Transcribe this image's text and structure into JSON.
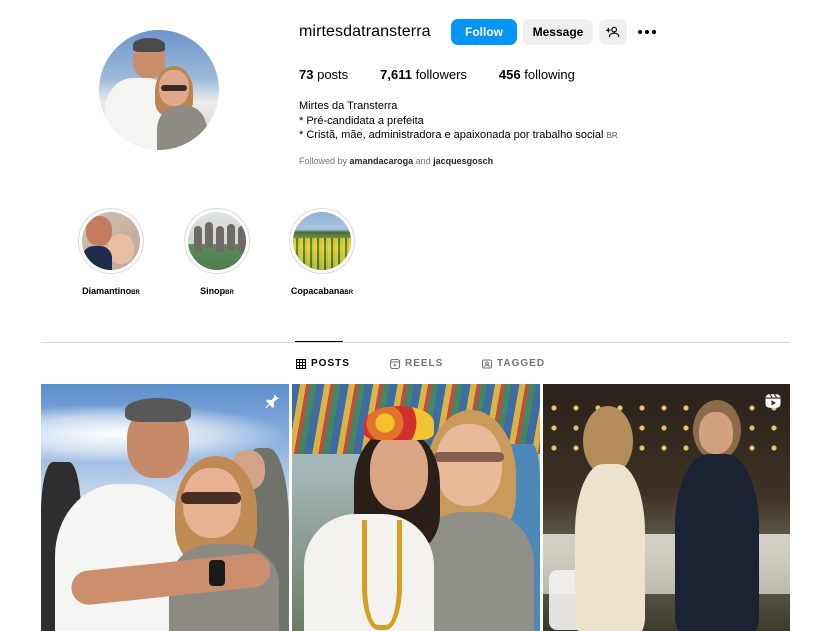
{
  "profile": {
    "username": "mirtesdatransterra",
    "stats": {
      "posts_count": "73",
      "posts_label": "posts",
      "followers_count": "7,611",
      "followers_label": "followers",
      "following_count": "456",
      "following_label": "following"
    },
    "full_name": "Mirtes da Transterra",
    "bio_lines": [
      "* Pré-candidata a prefeita",
      "* Cristã, mãe, administradora e apaixonada por trabalho social"
    ],
    "bio_tag": "BR",
    "followed_by": {
      "prefix": "Followed by",
      "user1": "amandacaroga",
      "and": "and",
      "user2": "jacquesgosch"
    }
  },
  "actions": {
    "follow_label": "Follow",
    "message_label": "Message",
    "add_user_icon": "person-add-icon",
    "more_icon": "more-horizontal-icon"
  },
  "highlights": [
    {
      "name": "Diamantino",
      "tag": "BR"
    },
    {
      "name": "Sinop",
      "tag": "BR"
    },
    {
      "name": "Copacabana",
      "tag": "BR"
    }
  ],
  "tabs": [
    {
      "label": "POSTS",
      "icon": "grid-icon",
      "active": true
    },
    {
      "label": "REELS",
      "icon": "reels-icon",
      "active": false
    },
    {
      "label": "TAGGED",
      "icon": "tagged-icon",
      "active": false
    }
  ],
  "posts": [
    {
      "badge": "pin-icon"
    },
    {
      "badge": ""
    },
    {
      "badge": "reel-icon"
    }
  ],
  "colors": {
    "follow_button": "#0095f6",
    "secondary_button": "#efefef",
    "muted_text": "#737373",
    "divider": "#dbdbdb"
  }
}
